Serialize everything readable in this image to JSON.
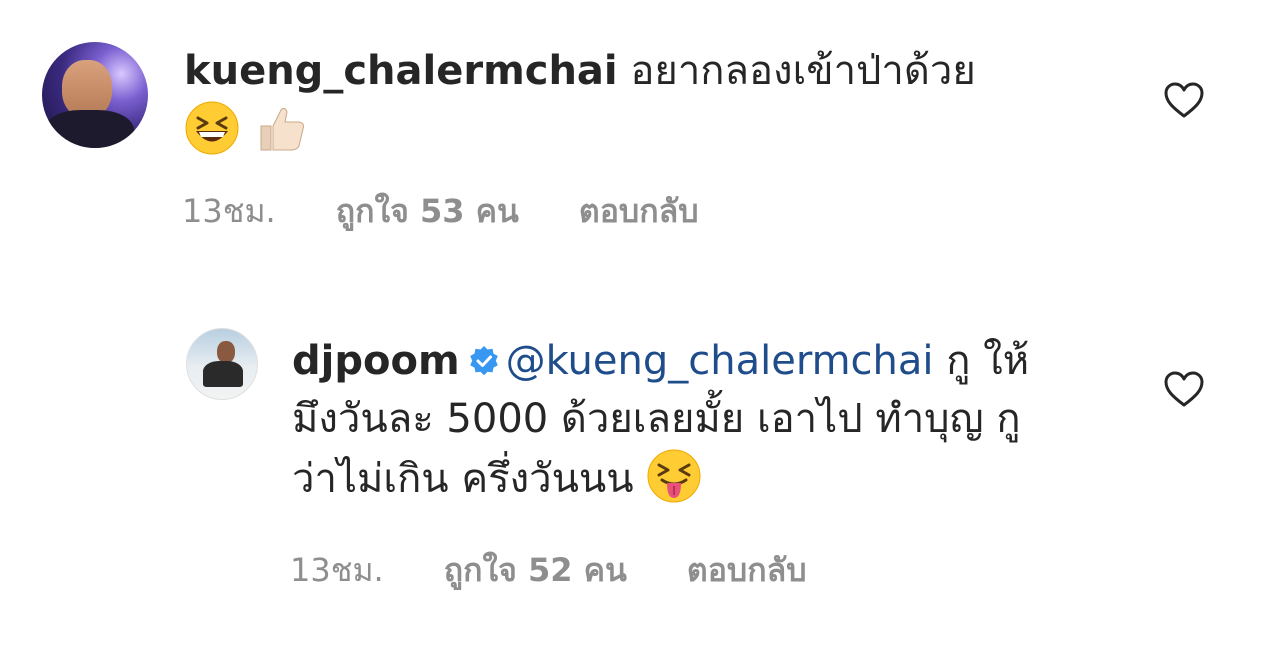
{
  "comments": [
    {
      "username": "kueng_chalermchai",
      "text": "อยากลองเข้าป่าด้วย",
      "emojis": [
        "grinning-squinting-face",
        "thumbs-up-light-skin"
      ],
      "time": "13ชม.",
      "likes": "ถูกใจ 53 คน",
      "reply": "ตอบกลับ",
      "verified": false
    },
    {
      "username": "djpoom",
      "verified": true,
      "mention": "@kueng_chalermchai",
      "text": "กู ให้มึงวันละ 5000 ด้วยเลยมั้ย เอาไป ทำบุญ กูว่าไม่เกิน ครึ่งวันนน",
      "emojis": [
        "squinting-face-with-tongue"
      ],
      "time": "13ชม.",
      "likes": "ถูกใจ 52 คน",
      "reply": "ตอบกลับ"
    }
  ],
  "colors": {
    "text": "#262626",
    "meta": "#8e8e8e",
    "mention": "#1f4d8c",
    "verified": "#3897f0"
  }
}
